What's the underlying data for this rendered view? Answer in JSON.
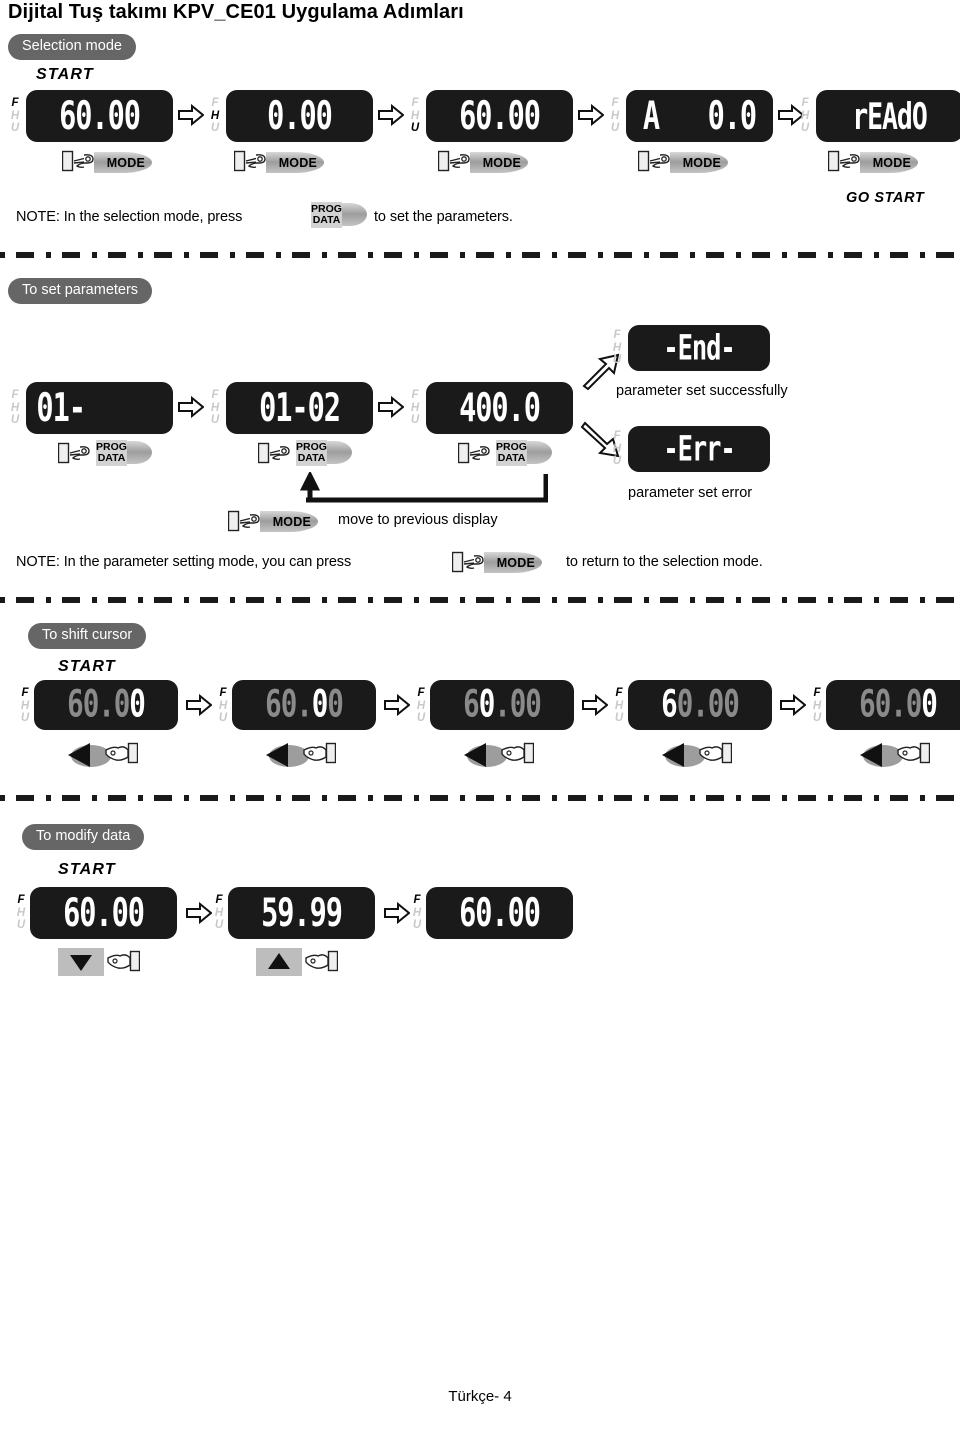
{
  "document": {
    "title": "Dijital Tuş takımı  KPV_CE01 Uygulama Adımları",
    "footer": "Türkçe-  4"
  },
  "labels": {
    "start": "START",
    "go_start": "GO START",
    "mode": "MODE",
    "prog": "PROG",
    "data": "DATA"
  },
  "sections": [
    {
      "id": "selection-mode",
      "pill": "Selection mode",
      "start": "START",
      "displays": [
        {
          "value": "60.00",
          "active": "F",
          "button": "MODE"
        },
        {
          "value": "0.00",
          "active": "H",
          "button": "MODE"
        },
        {
          "value": "60.00",
          "active": "U",
          "button": "MODE"
        },
        {
          "value": "A   0.0",
          "active": "",
          "button": "MODE"
        },
        {
          "value": "rEAdO",
          "active": "",
          "button": "MODE"
        }
      ],
      "go_start": "GO START",
      "note_before": "NOTE: In the selection mode, press",
      "note_after": "to set the parameters."
    },
    {
      "id": "to-set-parameters",
      "pill": "To set  parameters",
      "displays": [
        {
          "value": "01-",
          "align": "left",
          "button": "PROG DATA"
        },
        {
          "value": "01-02",
          "button": "PROG DATA"
        },
        {
          "value": "400.0",
          "button": "PROG DATA"
        }
      ],
      "outcomes": [
        {
          "value": "-End-",
          "caption": "parameter set successfully"
        },
        {
          "value": "-Err-",
          "caption": "parameter set error"
        }
      ],
      "return_caption": "move to previous display",
      "note_before": "NOTE: In the parameter setting mode, you can press",
      "note_after": "to return to the selection mode."
    },
    {
      "id": "to-shift-cursor",
      "pill": "To shift cursor",
      "start": "START",
      "displays": [
        {
          "value": "60.00",
          "cursor": 4,
          "active": "F",
          "button": "LEFT"
        },
        {
          "value": "60.00",
          "cursor": 3,
          "active": "F",
          "button": "LEFT"
        },
        {
          "value": "60.00",
          "cursor": 2,
          "active": "F",
          "button": "LEFT"
        },
        {
          "value": "60.00",
          "cursor": 1,
          "active": "F",
          "button": "LEFT"
        },
        {
          "value": "60.00",
          "cursor": 4,
          "active": "F",
          "button": "LEFT"
        }
      ]
    },
    {
      "id": "to-modify-data",
      "pill": "To modify data",
      "start": "START",
      "displays": [
        {
          "value": "60.00",
          "active": "F",
          "button": "DOWN"
        },
        {
          "value": "59.99",
          "active": "F",
          "button": "UP"
        },
        {
          "value": "60.00",
          "active": "F",
          "button": ""
        }
      ]
    }
  ],
  "colors": {
    "pill_bg": "#666666",
    "lcd_bg": "#1a1a1a",
    "lcd_text": "#ffffff",
    "lcd_dim": "#8a8a8a",
    "button_gray": "#9d9d9d"
  }
}
